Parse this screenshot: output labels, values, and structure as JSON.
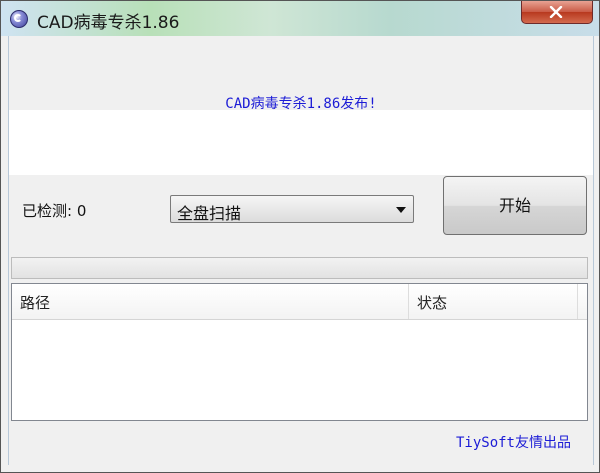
{
  "window": {
    "title": "CAD病毒专杀1.86"
  },
  "banner": {
    "text": "CAD病毒专杀1.86发布!"
  },
  "scan": {
    "detected_label": "已检测: 0",
    "mode_selected": "全盘扫描",
    "start_label": "开始"
  },
  "list": {
    "columns": [
      "路径",
      "状态"
    ]
  },
  "footer": {
    "credit": "TiySoft友情出品"
  },
  "colors": {
    "accent_text": "#1c1cd6",
    "close_button": "#c95a45"
  }
}
